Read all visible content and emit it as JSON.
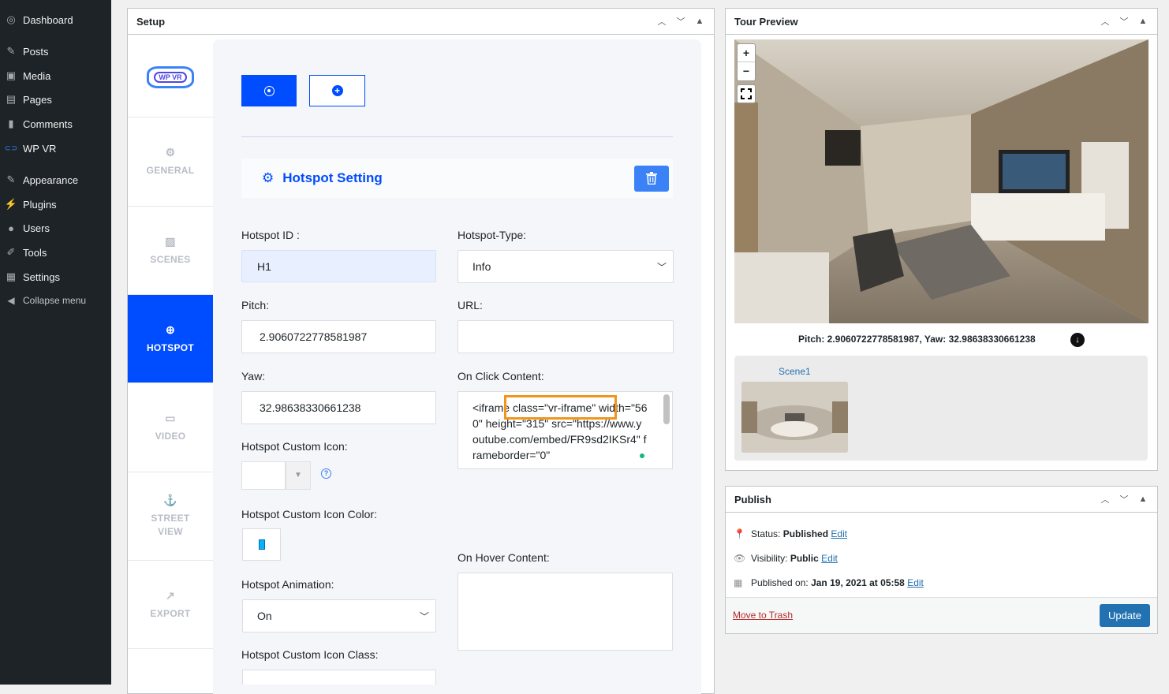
{
  "admin_menu": {
    "items": [
      {
        "icon": "dashboard-icon",
        "glyph": "◎",
        "label": "Dashboard"
      },
      {
        "icon": "posts-icon",
        "glyph": "✎",
        "label": "Posts"
      },
      {
        "icon": "media-icon",
        "glyph": "▣",
        "label": "Media"
      },
      {
        "icon": "pages-icon",
        "glyph": "▤",
        "label": "Pages"
      },
      {
        "icon": "comments-icon",
        "glyph": "▮",
        "label": "Comments"
      },
      {
        "icon": "wpvr-icon",
        "glyph": "⊂⊃",
        "label": "WP VR"
      },
      {
        "icon": "appearance-icon",
        "glyph": "✎",
        "label": "Appearance"
      },
      {
        "icon": "plugins-icon",
        "glyph": "⚡",
        "label": "Plugins"
      },
      {
        "icon": "users-icon",
        "glyph": "●",
        "label": "Users"
      },
      {
        "icon": "tools-icon",
        "glyph": "✐",
        "label": "Tools"
      },
      {
        "icon": "settings-icon",
        "glyph": "▦",
        "label": "Settings"
      },
      {
        "icon": "collapse-icon",
        "glyph": "◀",
        "label": "Collapse menu"
      }
    ]
  },
  "setup": {
    "title": "Setup",
    "logo_text": "WP VR",
    "tabs": [
      {
        "id": "general",
        "glyph": "⚙",
        "label": "GENERAL"
      },
      {
        "id": "scenes",
        "glyph": "▨",
        "label": "SCENES"
      },
      {
        "id": "hotspot",
        "glyph": "⊕",
        "label": "HOTSPOT",
        "active": true
      },
      {
        "id": "video",
        "glyph": "▭",
        "label": "VIDEO"
      },
      {
        "id": "street-view",
        "glyph": "⚓",
        "label": "STREET VIEW"
      },
      {
        "id": "export",
        "glyph": "↗",
        "label": "EXPORT"
      }
    ],
    "hotspot_setting_title": "Hotspot Setting",
    "fields": {
      "hotspot_id": {
        "label": "Hotspot ID :",
        "value": "H1"
      },
      "hotspot_type": {
        "label": "Hotspot-Type:",
        "value": "Info"
      },
      "pitch": {
        "label": "Pitch:",
        "value": "2.9060722778581987"
      },
      "url": {
        "label": "URL:",
        "value": ""
      },
      "yaw": {
        "label": "Yaw:",
        "value": "32.98638330661238"
      },
      "on_click": {
        "label": "On Click Content:",
        "value": "<iframe class=\"vr-iframe\" width=\"560\" height=\"315\" src=\"https://www.youtube.com/embed/FR9sd2IKSr4\" frameborder=\"0\""
      },
      "custom_icon": {
        "label": "Hotspot Custom Icon:"
      },
      "custom_icon_color": {
        "label": "Hotspot Custom Icon Color:",
        "value": "#00b4ff"
      },
      "on_hover": {
        "label": "On Hover Content:",
        "value": ""
      },
      "animation": {
        "label": "Hotspot Animation:",
        "value": "On"
      },
      "custom_icon_class": {
        "label": "Hotspot Custom Icon Class:"
      }
    }
  },
  "tour_preview": {
    "title": "Tour Preview",
    "zoom_in": "+",
    "zoom_out": "−",
    "coords": "Pitch: 2.9060722778581987, Yaw: 32.98638330661238",
    "scene_label": "Scene1"
  },
  "publish": {
    "title": "Publish",
    "status_label": "Status:",
    "status_value": "Published",
    "visibility_label": "Visibility:",
    "visibility_value": "Public",
    "published_label": "Published on:",
    "published_value": "Jan 19, 2021 at 05:58",
    "edit_label": "Edit",
    "trash_label": "Move to Trash",
    "update_label": "Update"
  },
  "colors": {
    "accent": "#004cff",
    "wp_blue": "#2271b1",
    "highlight": "#f0961e"
  }
}
